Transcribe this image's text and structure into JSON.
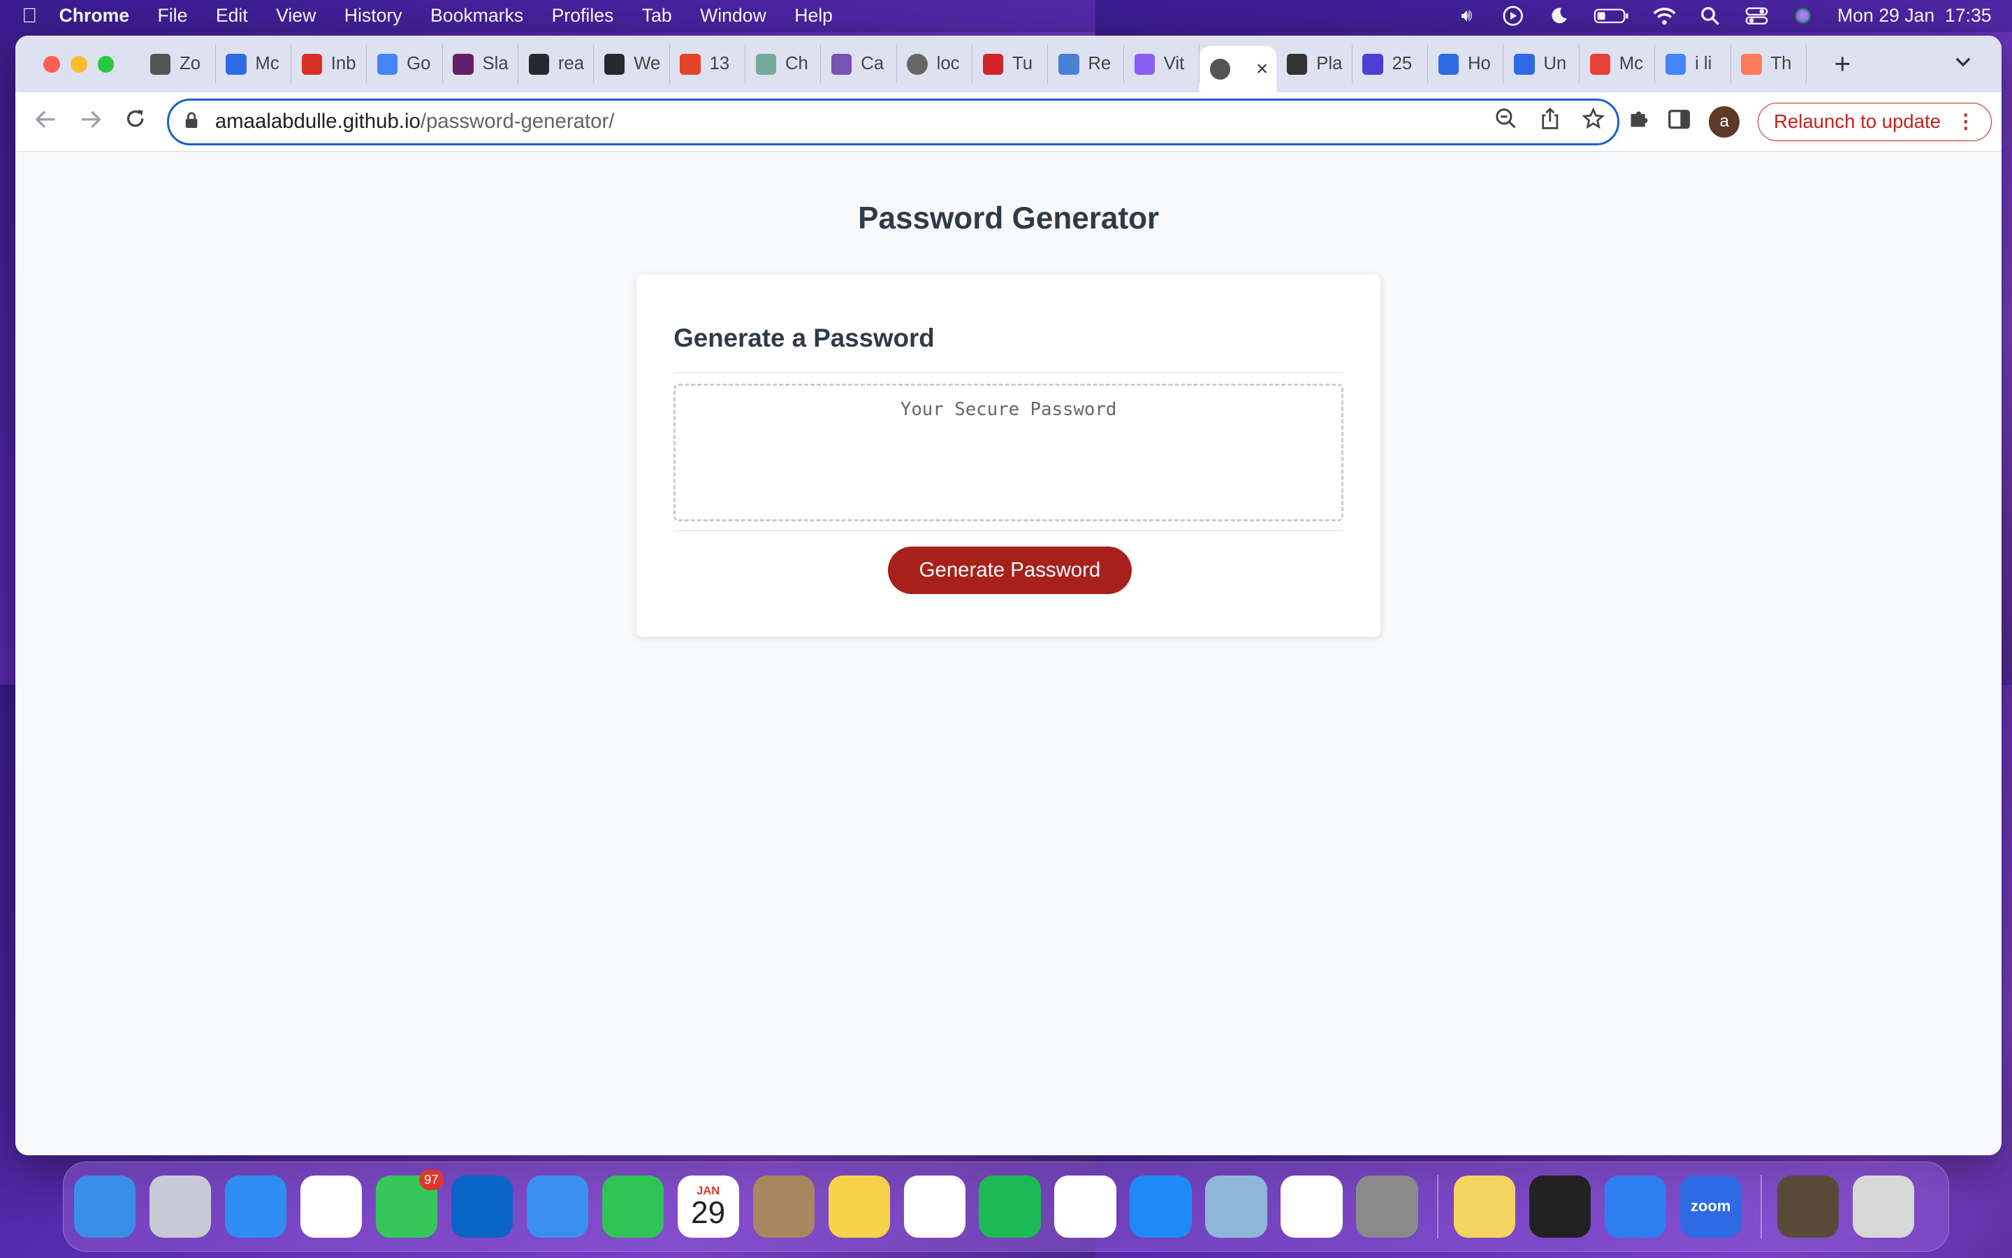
{
  "menubar": {
    "app": "Chrome",
    "items": [
      "File",
      "Edit",
      "View",
      "History",
      "Bookmarks",
      "Profiles",
      "Tab",
      "Window",
      "Help"
    ],
    "clock": "Mon 29 Jan  17:35",
    "status_icons": [
      "volume-icon",
      "play-icon",
      "moon-icon",
      "battery-icon",
      "wifi-icon",
      "spotlight-icon",
      "control-center-icon",
      "siri-icon"
    ]
  },
  "tabs": [
    {
      "label": "Zo",
      "icon": "zoho-icon",
      "color": "#555555"
    },
    {
      "label": "Mc",
      "icon": "zoom-icon",
      "color": "#2d6ae3"
    },
    {
      "label": "Inb",
      "icon": "gmail-icon",
      "color": "#d93025"
    },
    {
      "label": "Go",
      "icon": "google-calendar-icon",
      "color": "#4285f4"
    },
    {
      "label": "Sla",
      "icon": "slack-icon",
      "color": "#611f69"
    },
    {
      "label": "rea",
      "icon": "github-icon",
      "color": "#24292f"
    },
    {
      "label": "We",
      "icon": "github-icon",
      "color": "#24292f"
    },
    {
      "label": "13",
      "icon": "gitlab-icon",
      "color": "#e24329"
    },
    {
      "label": "Ch",
      "icon": "chatgpt-icon",
      "color": "#74aa9c"
    },
    {
      "label": "Ca",
      "icon": "bootstrap-icon",
      "color": "#7952b3"
    },
    {
      "label": "loc",
      "icon": "globe-icon",
      "color": "#666666"
    },
    {
      "label": "Tu",
      "icon": "tutorial-icon",
      "color": "#d2232a"
    },
    {
      "label": "Re",
      "icon": "react-icon",
      "color": "#4a7fd6"
    },
    {
      "label": "Vit",
      "icon": "vite-icon",
      "color": "#8b5cf6"
    },
    {
      "label": "",
      "icon": "globe-icon",
      "color": "#555555",
      "active": true
    },
    {
      "label": "Pla",
      "icon": "square-icon",
      "color": "#333333"
    },
    {
      "label": "25",
      "icon": "hashnode-icon",
      "color": "#4d3fd6"
    },
    {
      "label": "Ho",
      "icon": "c-icon",
      "color": "#2d6ae3"
    },
    {
      "label": "Un",
      "icon": "c-icon",
      "color": "#2d6ae3"
    },
    {
      "label": "Mc",
      "icon": "m-icon",
      "color": "#e84038"
    },
    {
      "label": "i li",
      "icon": "google-icon",
      "color": "#4285f4"
    },
    {
      "label": "Th",
      "icon": "hubspot-icon",
      "color": "#ff7a59"
    }
  ],
  "address_bar": {
    "host": "amaalabdulle.github.io",
    "path": "/password-generator/"
  },
  "relaunch_label": "Relaunch to update",
  "avatar_letter": "a",
  "page": {
    "title": "Password Generator",
    "card_title": "Generate a Password",
    "password_placeholder": "Your Secure Password",
    "password_value": "",
    "button_label": "Generate Password"
  },
  "dock": [
    {
      "name": "finder-icon",
      "color": "#3a8ee6"
    },
    {
      "name": "launchpad-icon",
      "color": "#c9c9d6"
    },
    {
      "name": "safari-icon",
      "color": "#2f8cf0"
    },
    {
      "name": "chrome-icon",
      "color": "#ffffff"
    },
    {
      "name": "messages-icon",
      "color": "#36c75a",
      "badge": "97"
    },
    {
      "name": "outlook-icon",
      "color": "#0a64c8"
    },
    {
      "name": "mail-icon",
      "color": "#3b8ff0"
    },
    {
      "name": "facetime-icon",
      "color": "#30c454"
    },
    {
      "name": "calendar-icon",
      "color": "#ffffff",
      "text": "29",
      "month": "JAN"
    },
    {
      "name": "contacts-icon",
      "color": "#a78660"
    },
    {
      "name": "notes-icon",
      "color": "#f6d24a"
    },
    {
      "name": "freeform-icon",
      "color": "#ffffff"
    },
    {
      "name": "spotify-icon",
      "color": "#1db954"
    },
    {
      "name": "news-icon",
      "color": "#ffffff"
    },
    {
      "name": "app-store-icon",
      "color": "#1f8af5"
    },
    {
      "name": "preview-icon",
      "color": "#8fb6d8"
    },
    {
      "name": "vscode-icon",
      "color": "#ffffff"
    },
    {
      "name": "system-settings-icon",
      "color": "#8a8a8a"
    },
    {
      "name": "stickies-icon",
      "color": "#f4d35e",
      "sep_before": true
    },
    {
      "name": "terminal-icon",
      "color": "#222222"
    },
    {
      "name": "xcode-icon",
      "color": "#2f7ef0"
    },
    {
      "name": "zoom-icon",
      "color": "#2d6ae3",
      "text": "zoom"
    },
    {
      "name": "downloads-stack-icon",
      "color": "#5a4a3a",
      "sep_before": true
    },
    {
      "name": "trash-icon",
      "color": "#d7d7d7"
    }
  ],
  "colors": {
    "accent_button": "#a8201a",
    "omnibox_border": "#1a5fd0",
    "relaunch": "#c5221f"
  }
}
